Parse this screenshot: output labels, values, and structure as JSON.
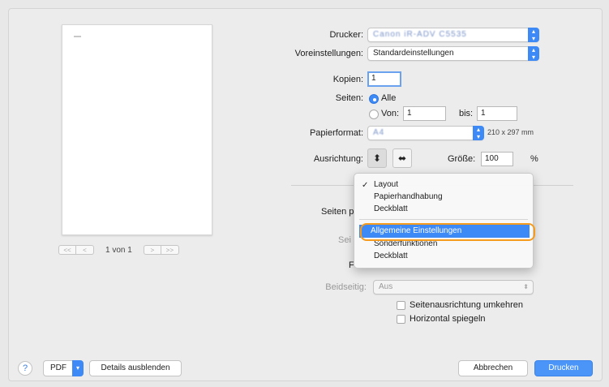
{
  "preview": {
    "page_indicator": "1 von 1",
    "first_label": "<<",
    "prev_label": "<",
    "next_label": ">",
    "last_label": ">>"
  },
  "form": {
    "printer_label": "Drucker:",
    "printer_value": "Canon iR-ADV C5535",
    "presets_label": "Voreinstellungen:",
    "presets_value": "Standardeinstellungen",
    "copies_label": "Kopien:",
    "copies_value": "1",
    "pages_label": "Seiten:",
    "pages_all": "Alle",
    "pages_from_label": "Von:",
    "pages_from_value": "1",
    "pages_to_label": "bis:",
    "pages_to_value": "1",
    "paper_label": "Papierformat:",
    "paper_value": "A4",
    "paper_size": "210 x 297 mm",
    "orientation_label": "Ausrichtung:",
    "scale_label": "Größe:",
    "scale_value": "100",
    "scale_unit": "%",
    "pages_per_sheet_partial": "Seiten p",
    "border_partial": "Sei",
    "layout_direction_partial": "F",
    "duplex_label": "Beidseitig:",
    "duplex_value": "Aus",
    "reverse_orientation": "Seitenausrichtung umkehren",
    "flip_horizontal": "Horizontal spiegeln"
  },
  "menu": {
    "items_group1": [
      "Layout",
      "Papierhandhabung",
      "Deckblatt"
    ],
    "checked_item": "Layout",
    "items_group2": [
      "Allgemeine Einstellungen",
      "Sonderfunktionen",
      "Deckblatt"
    ],
    "highlighted_item": "Allgemeine Einstellungen"
  },
  "footer": {
    "help_label": "?",
    "pdf_label": "PDF",
    "details_label": "Details ausblenden",
    "cancel_label": "Abbrechen",
    "print_label": "Drucken"
  },
  "colors": {
    "accent": "#3d8af7",
    "highlight_outline": "#f59c1e"
  }
}
